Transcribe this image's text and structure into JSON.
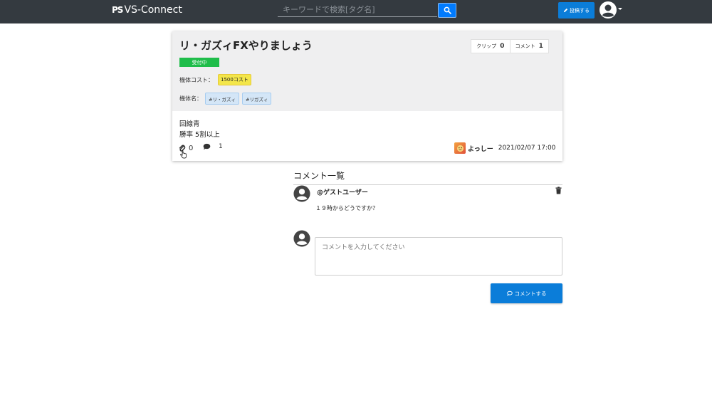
{
  "header": {
    "brand_mark": "PS",
    "brand": "VS-Connect",
    "search_placeholder": "キーワードで検索[タグ名]",
    "post_label": "投稿する"
  },
  "post": {
    "title": "リ・ガズィFXやりましょう",
    "stats": {
      "clip_label": "クリップ",
      "clip_count": "0",
      "comment_label": "コメント",
      "comment_count": "1"
    },
    "status": "受付中",
    "cost_label": "機体コスト：",
    "cost_value": "1500コスト",
    "machine_label": "機体名：",
    "tags": [
      "#リ・ガズィ",
      "#リガズィ"
    ],
    "body_lines": [
      "回線青",
      "勝率 5割以上"
    ],
    "clip_count": "0",
    "comment_count": "1",
    "author": "よっしー",
    "date": "2021/02/07 17:00"
  },
  "comments": {
    "title": "コメント一覧",
    "items": [
      {
        "user": "@ゲストユーザー",
        "text": "１９時からどうですか？"
      }
    ],
    "input_placeholder": "コメントを入力してください",
    "submit_label": "コメントする"
  },
  "colors": {
    "navbar": "#343a40",
    "primary": "#0b7dd9",
    "status": "#1fbd4a",
    "cost_badge": "#f3e64a",
    "tag": "#d4e6f7"
  }
}
